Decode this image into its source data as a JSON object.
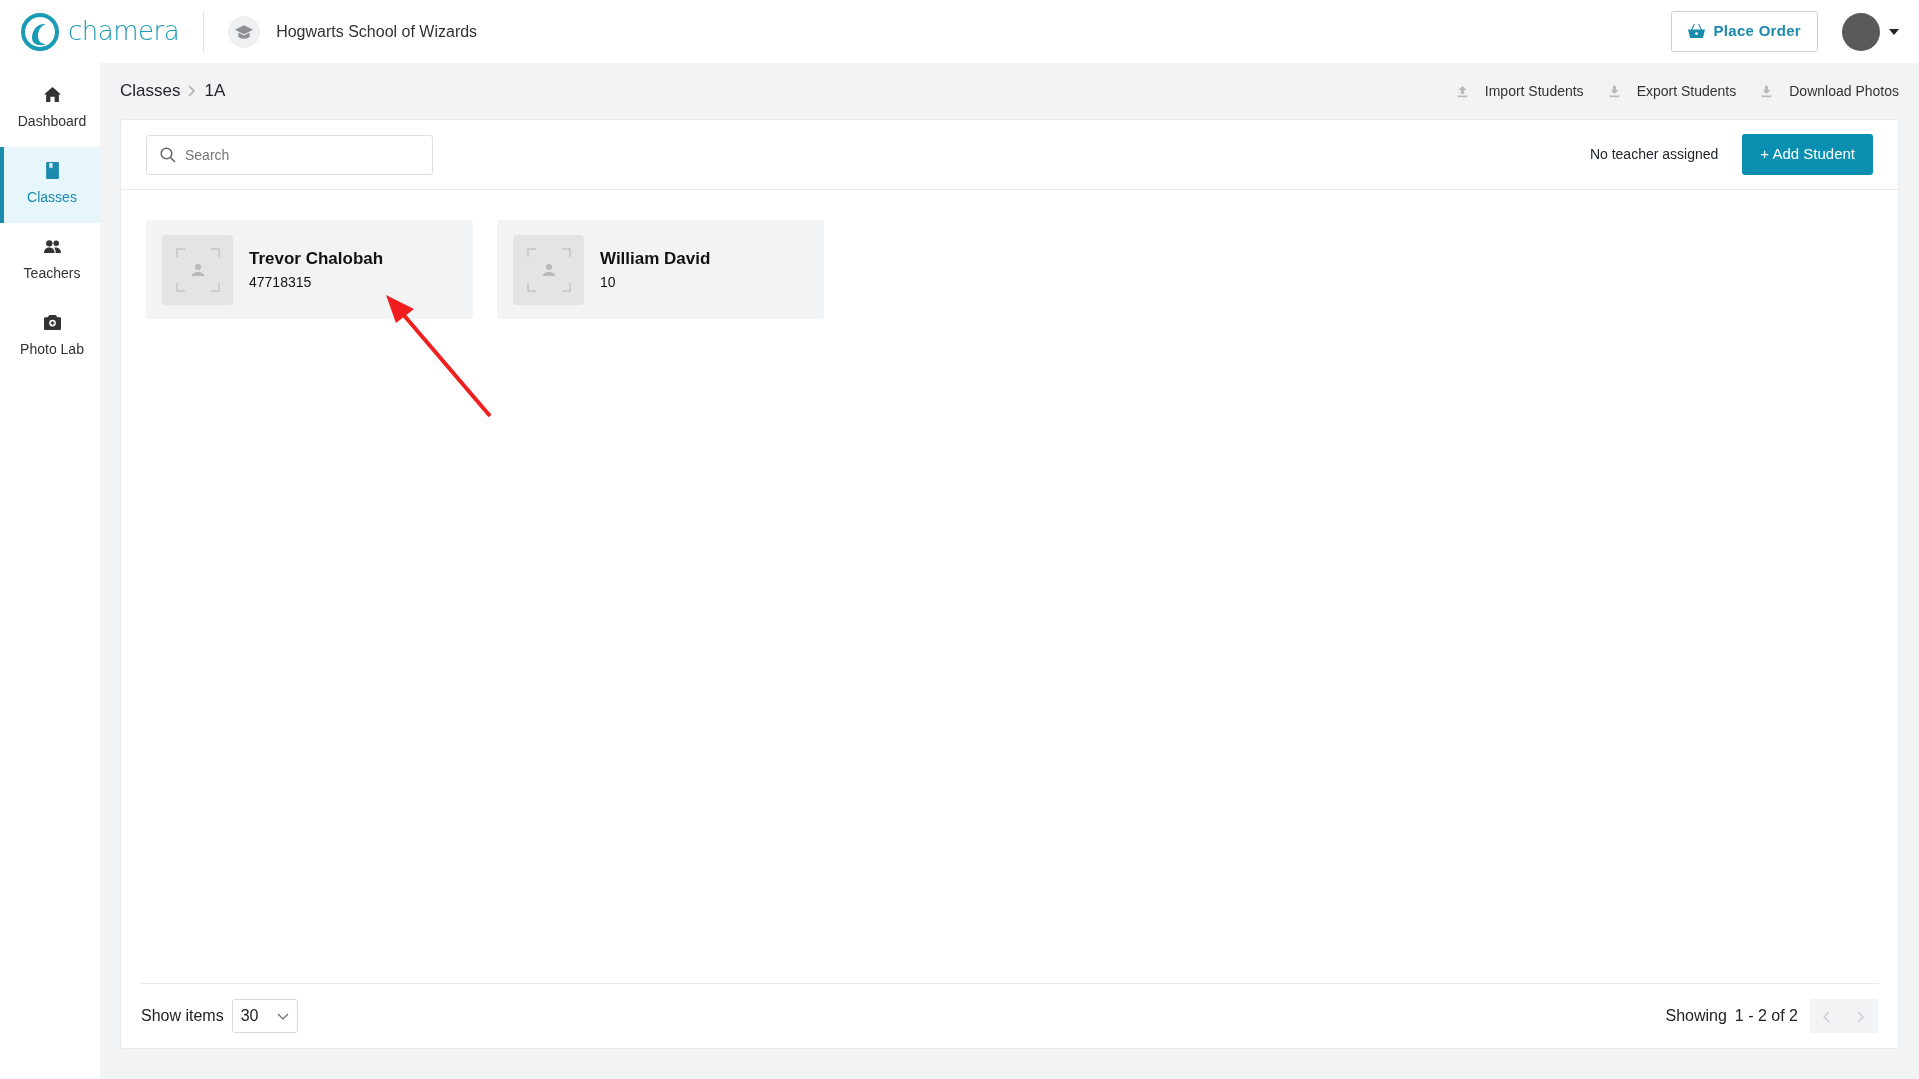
{
  "header": {
    "logo_text": "chamera",
    "school": "Hogwarts School of Wizards",
    "place_order": "Place Order"
  },
  "sidebar": {
    "items": [
      {
        "label": "Dashboard",
        "kind": "home",
        "selected": false
      },
      {
        "label": "Classes",
        "kind": "book",
        "selected": true
      },
      {
        "label": "Teachers",
        "kind": "people",
        "selected": false
      },
      {
        "label": "Photo Lab",
        "kind": "camera",
        "selected": false
      }
    ]
  },
  "breadcrumb": [
    "Classes",
    "1A"
  ],
  "actions": [
    {
      "label": "Import Students",
      "kind": "upload"
    },
    {
      "label": "Export Students",
      "kind": "download"
    },
    {
      "label": "Download Photos",
      "kind": "download"
    }
  ],
  "search": {
    "placeholder": "Search"
  },
  "teacher_note": "No teacher assigned",
  "add_button": "+ Add Student",
  "students": [
    {
      "name": "Trevor Chalobah",
      "number": "47718315"
    },
    {
      "name": "William David",
      "number": "10"
    }
  ],
  "footer": {
    "show_items_label": "Show items",
    "page_size": "30",
    "showing_label": "Showing",
    "range": "1 - 2 of 2",
    "prev_disabled": true,
    "next_disabled": true
  }
}
